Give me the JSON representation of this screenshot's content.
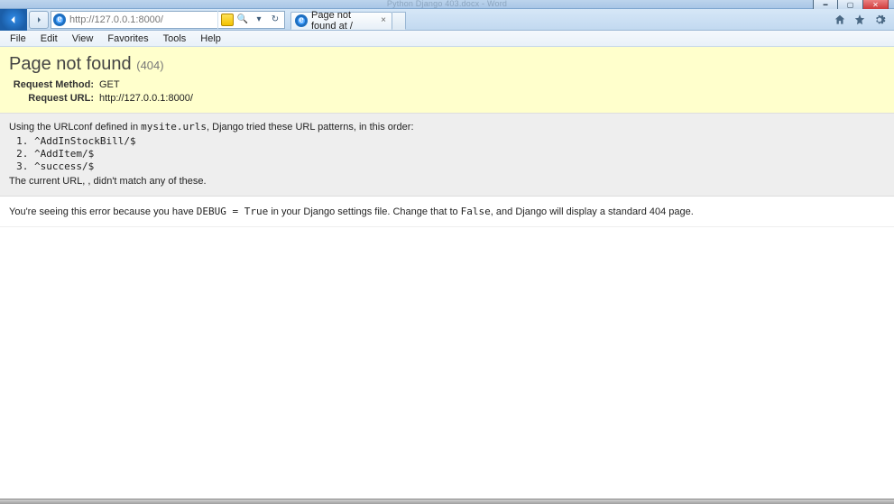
{
  "window": {
    "faint_title": "Python Django 403.docx - Word"
  },
  "nav": {
    "url": "http://127.0.0.1:8000/",
    "search_symbol": "🔍",
    "refresh_symbol": "↻",
    "dropdown_symbol": "▾"
  },
  "tab": {
    "title": "Page not found at /",
    "close_symbol": "×"
  },
  "menu": {
    "items": [
      "File",
      "Edit",
      "View",
      "Favorites",
      "Tools",
      "Help"
    ]
  },
  "django": {
    "title": "Page not found",
    "status_code": "(404)",
    "request_method_label": "Request Method:",
    "request_method": "GET",
    "request_url_label": "Request URL:",
    "request_url": "http://127.0.0.1:8000/",
    "urlconf_pre": "Using the URLconf defined in ",
    "urlconf_module": "mysite.urls",
    "urlconf_post": ", Django tried these URL patterns, in this order:",
    "patterns": [
      "^AddInStockBill/$",
      "^AddItem/$",
      "^success/$"
    ],
    "nomatch": "The current URL, , didn't match any of these.",
    "explain_pre": "You're seeing this error because you have ",
    "explain_code": "DEBUG = True",
    "explain_mid": " in your Django settings file. Change that to ",
    "explain_code2": "False",
    "explain_post": ", and Django will display a standard 404 page."
  }
}
